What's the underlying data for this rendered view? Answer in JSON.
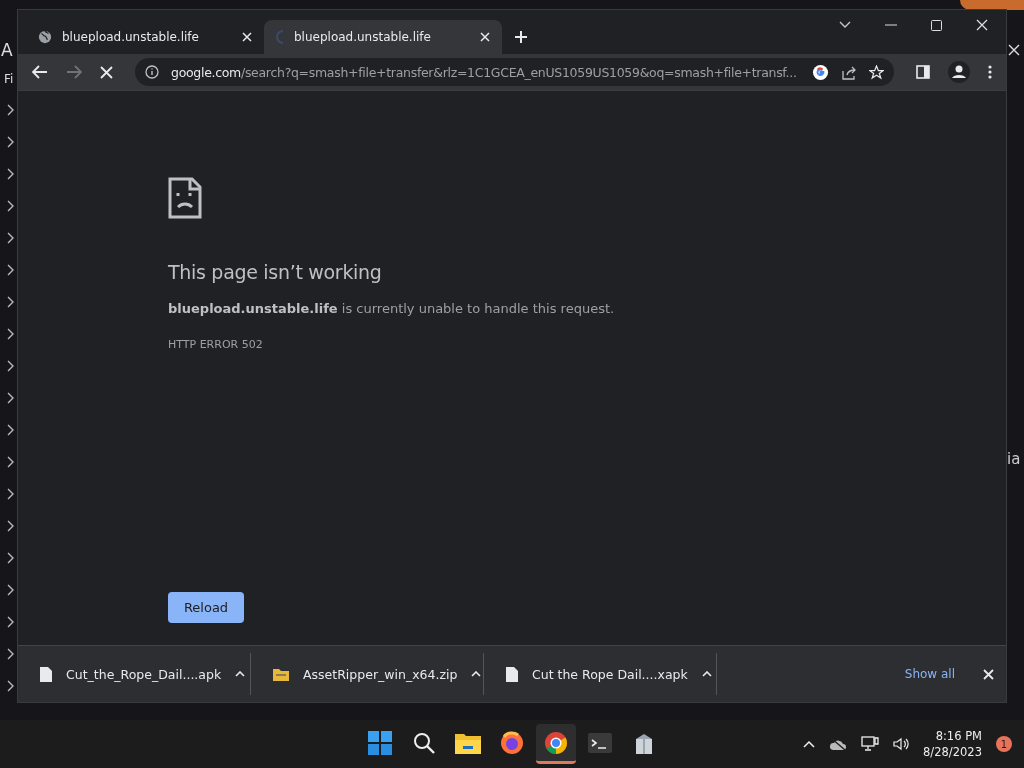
{
  "background_app": {
    "title": "A",
    "menu": "Fi",
    "side_text": "ia"
  },
  "browser": {
    "tabs": [
      {
        "title": "bluepload.unstable.life",
        "selected": false,
        "loading": false
      },
      {
        "title": "bluepload.unstable.life",
        "selected": true,
        "loading": true
      }
    ],
    "address": {
      "host": "google.com",
      "path": "/search?q=smash+file+transfer&rlz=1C1GCEA_enUS1059US1059&oq=smash+file+transf..."
    },
    "error": {
      "heading": "This page isn’t working",
      "message": "**bluepload.unstable.life** is currently unable to handle this request.",
      "code": "HTTP ERROR 502",
      "button": "Reload"
    },
    "downloads": [
      {
        "name": "Cut_the_Rope_Dail....apk",
        "kind": "file"
      },
      {
        "name": "AssetRipper_win_x64.zip",
        "kind": "zip"
      },
      {
        "name": "Cut the Rope Dail....xapk",
        "kind": "file"
      }
    ],
    "show_all": "Show all"
  },
  "taskbar": {
    "apps": [
      {
        "kind": "start",
        "active": false
      },
      {
        "kind": "search",
        "active": false
      },
      {
        "kind": "folder",
        "active": false
      },
      {
        "kind": "firefox",
        "active": false
      },
      {
        "kind": "chrome",
        "active": true
      },
      {
        "kind": "terminal",
        "active": false
      },
      {
        "kind": "box",
        "active": false
      }
    ],
    "time": "8:16 PM",
    "date": "8/28/2023",
    "notifications": "1"
  }
}
